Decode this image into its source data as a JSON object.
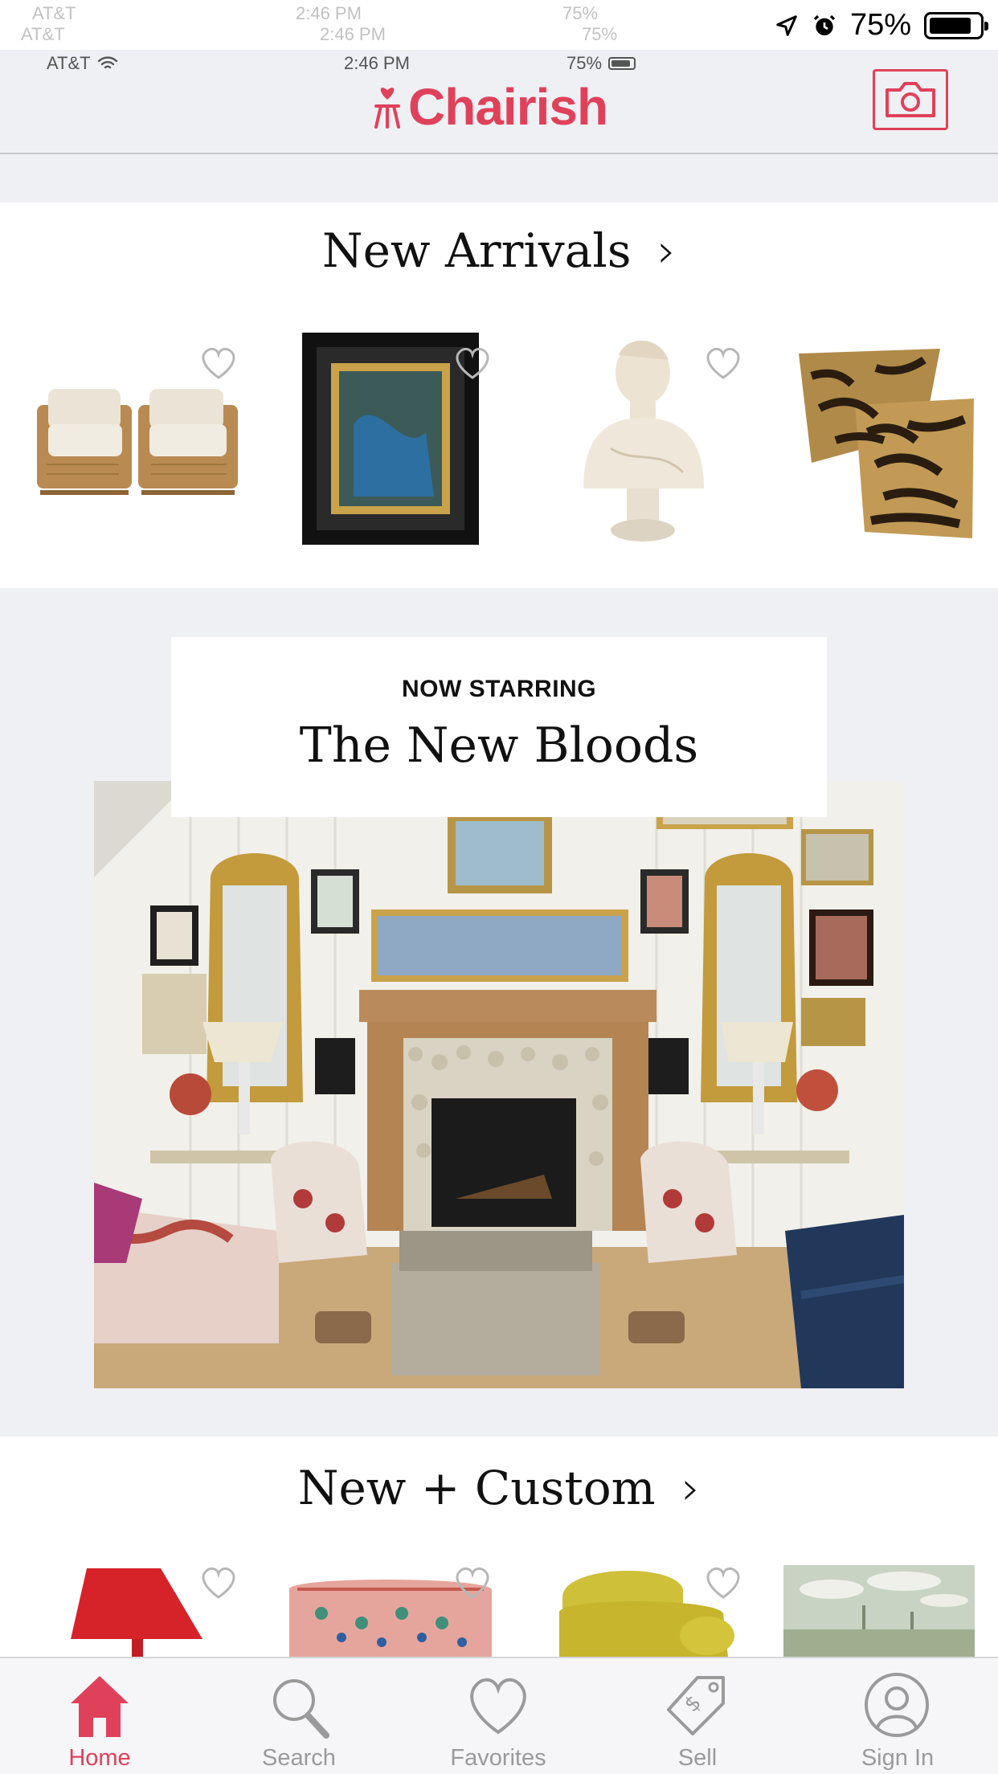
{
  "status_bar": {
    "carrier": "AT&T",
    "time": "2:46 PM",
    "battery_percent": "75%",
    "battery_level": 0.75,
    "icons": [
      "wifi-icon",
      "location-arrow-icon",
      "alarm-icon",
      "battery-icon"
    ]
  },
  "header": {
    "brand": "Chairish",
    "brand_color": "#e0415a",
    "camera_icon": "camera-icon"
  },
  "sections": {
    "new_arrivals": {
      "title": "New Arrivals",
      "chevron": "›",
      "products": [
        {
          "name": "pair-of-rattan-lounge-chairs",
          "favorited": false
        },
        {
          "name": "framed-blue-abstract-painting",
          "favorited": false
        },
        {
          "name": "classical-plaster-bust",
          "favorited": false
        },
        {
          "name": "tiger-print-pillows",
          "favorited": false
        }
      ]
    },
    "feature": {
      "eyebrow": "NOW STARRING",
      "title": "The New Bloods",
      "image": "eclectic-living-room-with-fireplace"
    },
    "new_custom": {
      "title": "New + Custom",
      "chevron": "›",
      "products": [
        {
          "name": "red-lamp",
          "favorited": false
        },
        {
          "name": "painted-ceramic-stool",
          "favorited": false
        },
        {
          "name": "yellow-armchair",
          "favorited": false
        },
        {
          "name": "landscape-mural-panel",
          "favorited": false
        }
      ]
    }
  },
  "tabbar": {
    "items": [
      {
        "label": "Home",
        "icon": "home-icon",
        "active": true
      },
      {
        "label": "Search",
        "icon": "search-icon",
        "active": false
      },
      {
        "label": "Favorites",
        "icon": "heart-icon",
        "active": false
      },
      {
        "label": "Sell",
        "icon": "price-tag-icon",
        "active": false
      },
      {
        "label": "Sign In",
        "icon": "user-icon",
        "active": false
      }
    ],
    "active_color": "#e0415a",
    "inactive_color": "#9a9a9a"
  }
}
